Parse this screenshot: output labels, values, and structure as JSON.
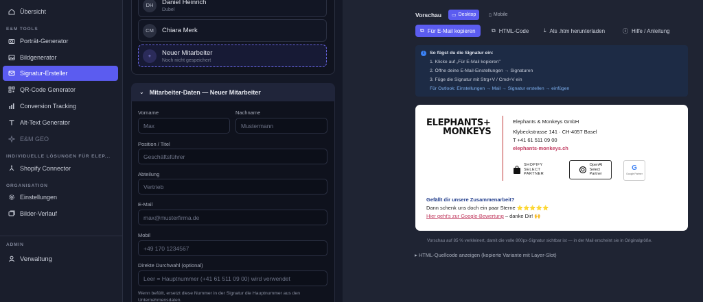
{
  "sidebar": {
    "overview": "Übersicht",
    "tools_section": "E&M TOOLS",
    "tools": [
      {
        "label": "Porträt-Generator",
        "icon": "camera-icon"
      },
      {
        "label": "Bildgenerator",
        "icon": "image-icon"
      },
      {
        "label": "Signatur-Ersteller",
        "icon": "mail-icon"
      },
      {
        "label": "QR-Code Generator",
        "icon": "qr-icon"
      },
      {
        "label": "Conversion Tracking",
        "icon": "bar-chart-icon"
      },
      {
        "label": "Alt-Text Generator",
        "icon": "text-icon"
      },
      {
        "label": "E&M GEO",
        "icon": "sparkle-icon"
      }
    ],
    "custom_section": "INDIVIDUELLE LÖSUNGEN FÜR ELEP...",
    "shopify": "Shopify Connector",
    "org_section": "ORGANISATION",
    "settings": "Einstellungen",
    "history": "Bilder-Verlauf",
    "admin_section": "ADMIN",
    "admin": "Verwaltung"
  },
  "employees": [
    {
      "initials": "DH",
      "name": "Daniel Heinrich",
      "sub": "Dubel"
    },
    {
      "initials": "CM",
      "name": "Chiara Merk",
      "sub": ""
    },
    {
      "initials": "+",
      "name": "Neuer Mitarbeiter",
      "sub": "Noch nicht gespeichert"
    }
  ],
  "form": {
    "header": "Mitarbeiter-Daten — Neuer Mitarbeiter",
    "vorname_label": "Vorname",
    "vorname_ph": "Max",
    "nachname_label": "Nachname",
    "nachname_ph": "Mustermann",
    "position_label": "Position / Titel",
    "position_ph": "Geschäftsführer",
    "abteilung_label": "Abteilung",
    "abteilung_ph": "Vertrieb",
    "email_label": "E-Mail",
    "email_ph": "max@musterfirma.de",
    "mobil_label": "Mobil",
    "mobil_ph": "+49 170 1234567",
    "durchwahl_label": "Direkte Durchwahl (optional)",
    "durchwahl_ph": "Leer = Hauptnummer (+41 61 511 09 00) wird verwendet",
    "hint": "Wenn befüllt, ersetzt diese Nummer in der Signatur die Hauptnummer aus den Unternehmensdaten."
  },
  "preview": {
    "title": "Vorschau",
    "desktop": "Desktop",
    "mobile": "Mobile",
    "copy_btn": "Für E-Mail kopieren",
    "html_btn": "HTML-Code",
    "download_btn": "Als .htm herunterladen",
    "help_btn": "Hilfe / Anleitung",
    "info_title": "So fügst du die Signatur ein:",
    "info_1": "1. Klicke auf „Für E-Mail kopieren\"",
    "info_2": "2. Öffne deine E-Mail-Einstellungen → Signaturen",
    "info_3": "3. Füge die Signatur mit Strg+V / Cmd+V ein",
    "info_4": "Für Outlook: Einstellungen → Mail → Signatur erstellen → einfügen",
    "note": "Vorschau auf 85 % verkleinert, damit die volle 800px-Signatur sichtbar ist — in der Mail erscheint sie in Originalgröße.",
    "source": "▸ HTML-Quellcode anzeigen (kopierte Variante mit Layer-Slot)"
  },
  "signature": {
    "logo_line1": "ELEPHANTS+",
    "logo_line2": "MONKEYS",
    "company": "Elephants & Monkeys GmbH",
    "address": "Klybeckstrasse 141 · CH-4057 Basel",
    "phone": "T +41 61 511 09 00",
    "web": "elephants-monkeys.ch",
    "badge_shopify": "SHOPIFY\nSELECT\nPARTNER",
    "badge_openai": "OpenAI\nSelect\nPartner",
    "badge_google": "Google Partner",
    "question": "Gefällt dir unsere Zusammenarbeit?",
    "stars_text": "Dann schenk uns doch ein paar Sterne ⭐⭐⭐⭐⭐",
    "review_link": "Hier geht's zur Google-Bewertung",
    "review_tail": " – danke Dir! 🙌"
  },
  "colors": {
    "accent": "#5b5cf0",
    "bg": "#1b1f2e",
    "link": "#c0395e"
  }
}
